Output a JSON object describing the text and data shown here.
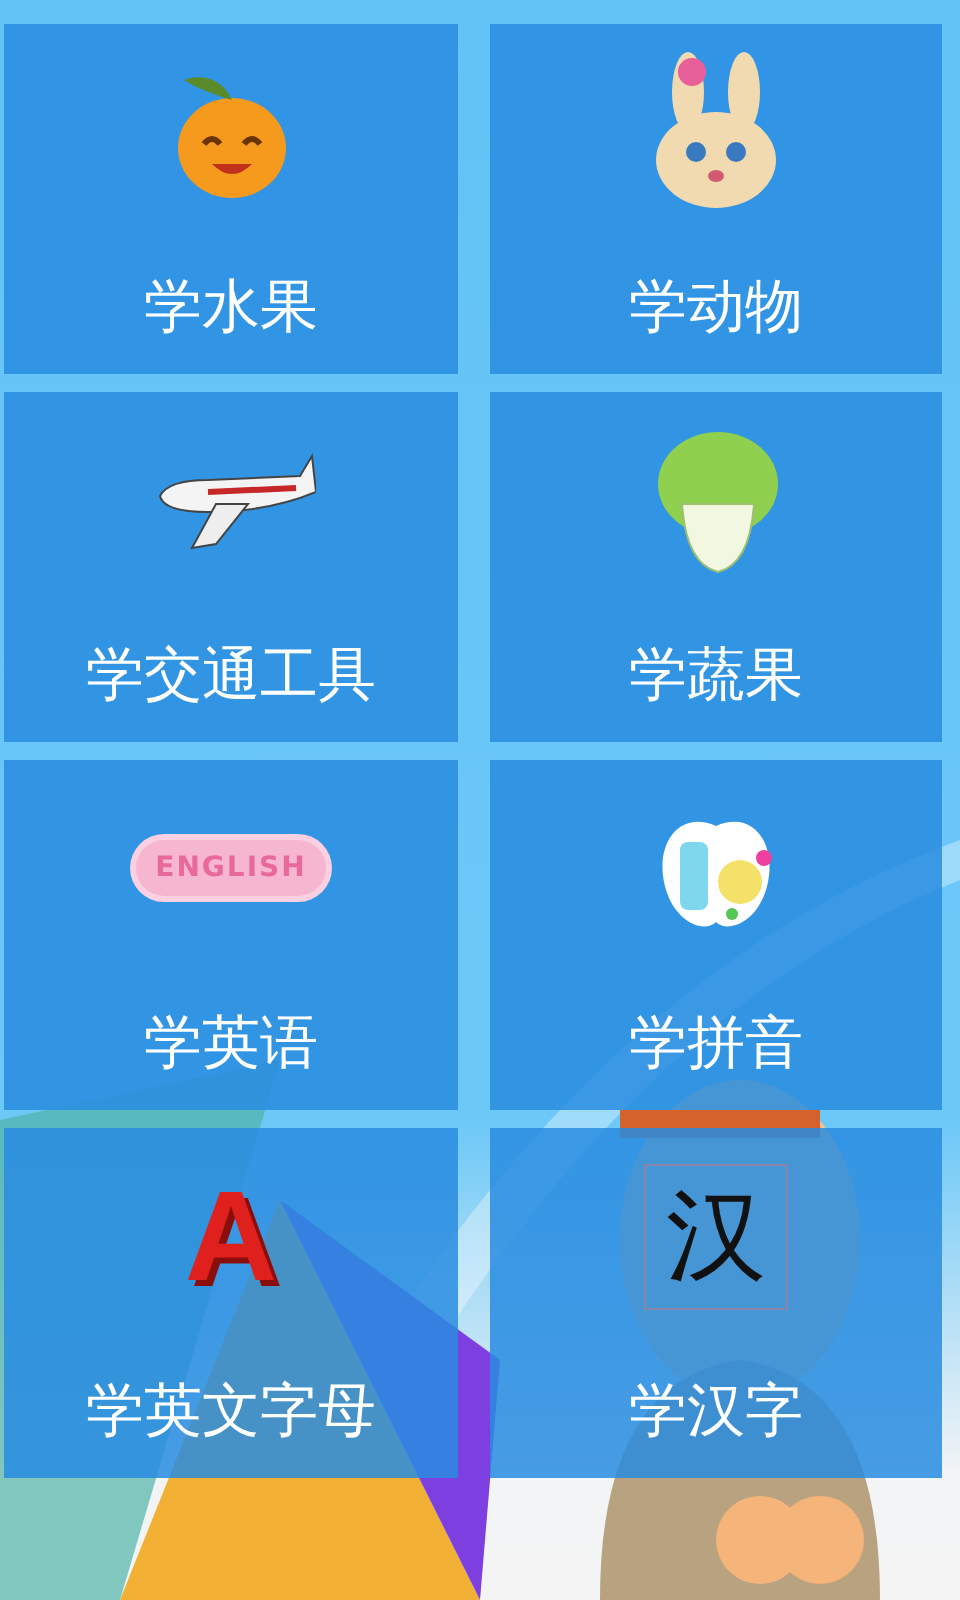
{
  "tiles": [
    {
      "label": "学水果",
      "kind": "fruit"
    },
    {
      "label": "学动物",
      "kind": "animal"
    },
    {
      "label": "学交通工具",
      "kind": "vehicle"
    },
    {
      "label": "学蔬果",
      "kind": "vegetable"
    },
    {
      "label": "学英语",
      "kind": "badge",
      "glyph": "ENGLISH"
    },
    {
      "label": "学拼音",
      "kind": "pinyin"
    },
    {
      "label": "学英文字母",
      "kind": "letter",
      "glyph": "A"
    },
    {
      "label": "学汉字",
      "kind": "hanzi",
      "glyph": "汉"
    }
  ]
}
